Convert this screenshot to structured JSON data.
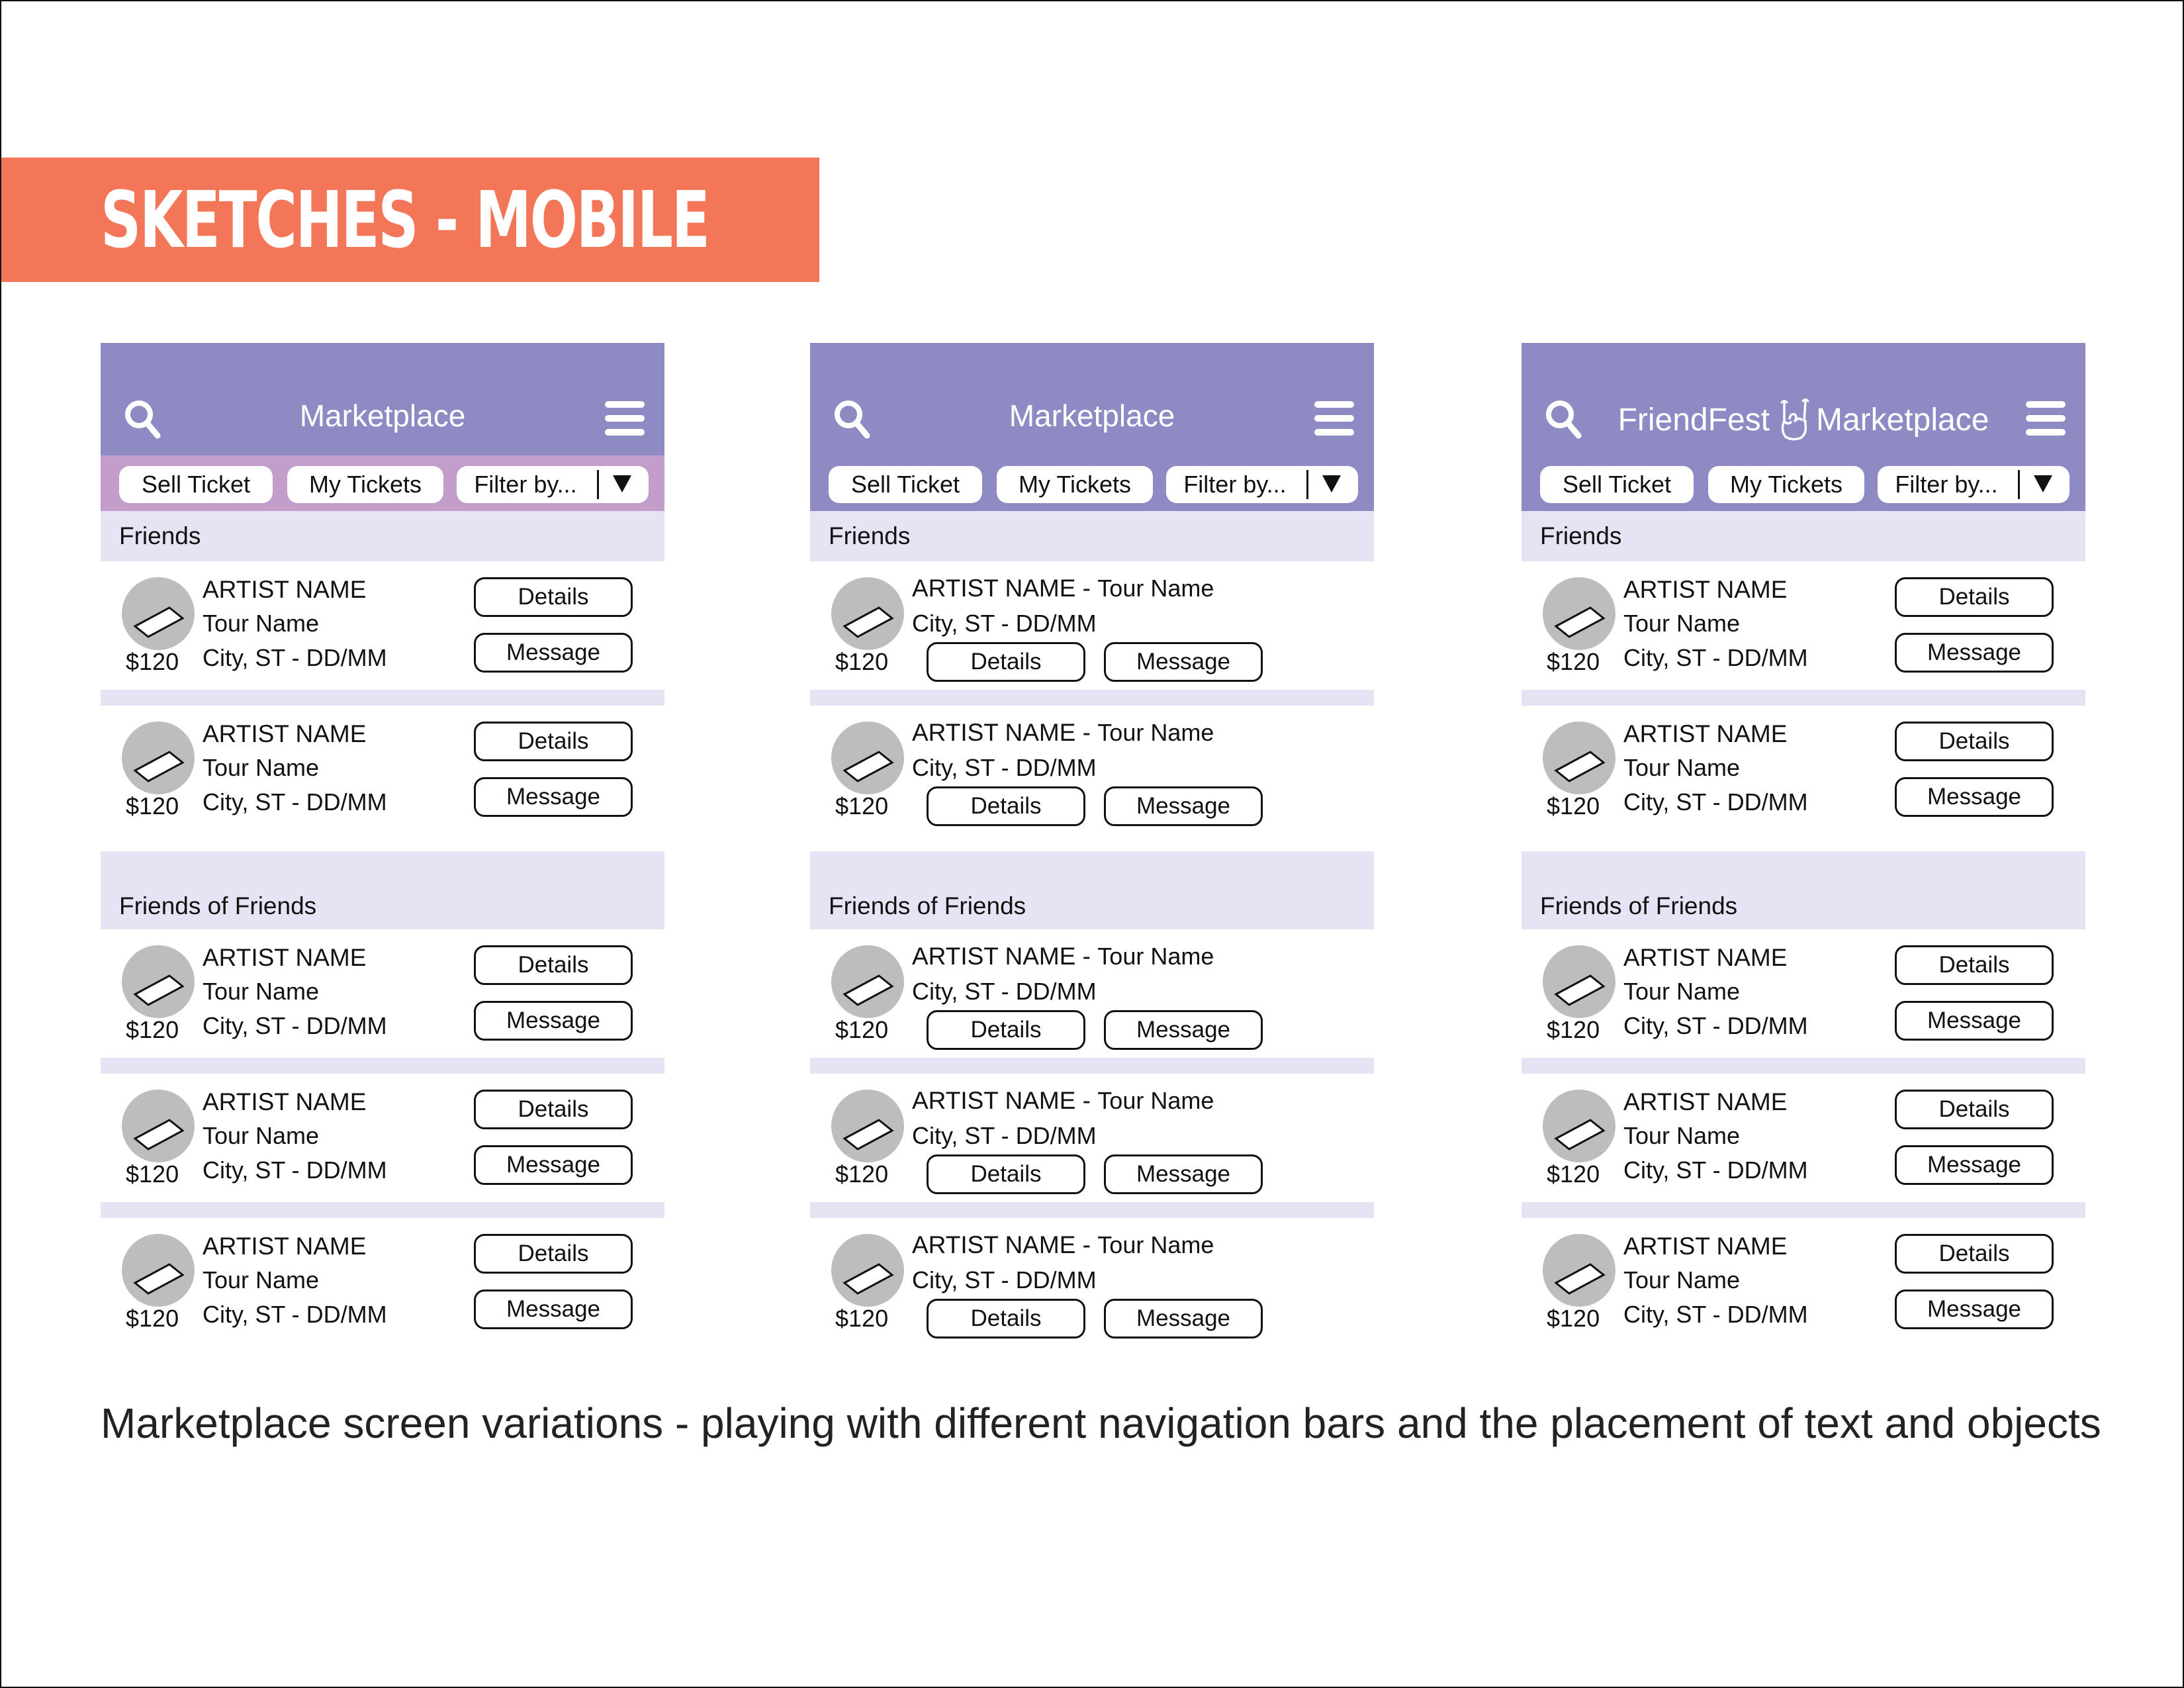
{
  "banner": {
    "title": "SKETCHES - MOBILE",
    "color": "#f47658"
  },
  "colors": {
    "header": "#8d8ac4",
    "subbar_alt": "#c39ecb",
    "section": "#e6e4f4",
    "avatar": "#bdbdbd"
  },
  "phones": [
    {
      "title": "Marketplace",
      "brand": "",
      "nav": {
        "sell": "Sell Ticket",
        "my": "My Tickets",
        "filter": "Filter by..."
      },
      "sections": {
        "friends": "Friends",
        "fof": "Friends of Friends"
      },
      "cards": [
        {
          "artist": "ARTIST NAME",
          "tour": "Tour Name",
          "city": "City, ST - DD/MM",
          "price": "$120",
          "details": "Details",
          "message": "Message"
        },
        {
          "artist": "ARTIST NAME",
          "tour": "Tour Name",
          "city": "City, ST - DD/MM",
          "price": "$120",
          "details": "Details",
          "message": "Message"
        },
        {
          "artist": "ARTIST NAME",
          "tour": "Tour Name",
          "city": "City, ST - DD/MM",
          "price": "$120",
          "details": "Details",
          "message": "Message"
        },
        {
          "artist": "ARTIST NAME",
          "tour": "Tour Name",
          "city": "City, ST - DD/MM",
          "price": "$120",
          "details": "Details",
          "message": "Message"
        },
        {
          "artist": "ARTIST NAME",
          "tour": "Tour Name",
          "city": "City, ST - DD/MM",
          "price": "$120",
          "details": "Details",
          "message": "Message"
        }
      ]
    },
    {
      "title": "Marketplace",
      "brand": "",
      "nav": {
        "sell": "Sell Ticket",
        "my": "My Tickets",
        "filter": "Filter by..."
      },
      "sections": {
        "friends": "Friends",
        "fof": "Friends of Friends"
      },
      "cards": [
        {
          "artist": "ARTIST NAME",
          "tour": "Tour Name",
          "city": "City, ST - DD/MM",
          "price": "$120",
          "details": "Details",
          "message": "Message"
        },
        {
          "artist": "ARTIST NAME",
          "tour": "Tour Name",
          "city": "City, ST - DD/MM",
          "price": "$120",
          "details": "Details",
          "message": "Message"
        },
        {
          "artist": "ARTIST NAME",
          "tour": "Tour Name",
          "city": "City, ST - DD/MM",
          "price": "$120",
          "details": "Details",
          "message": "Message"
        },
        {
          "artist": "ARTIST NAME",
          "tour": "Tour Name",
          "city": "City, ST - DD/MM",
          "price": "$120",
          "details": "Details",
          "message": "Message"
        },
        {
          "artist": "ARTIST NAME",
          "tour": "Tour Name",
          "city": "City, ST - DD/MM",
          "price": "$120",
          "details": "Details",
          "message": "Message"
        }
      ]
    },
    {
      "title": "Marketplace",
      "brand": "FriendFest",
      "nav": {
        "sell": "Sell Ticket",
        "my": "My Tickets",
        "filter": "Filter by..."
      },
      "sections": {
        "friends": "Friends",
        "fof": "Friends of Friends"
      },
      "cards": [
        {
          "artist": "ARTIST NAME",
          "tour": "Tour Name",
          "city": "City, ST - DD/MM",
          "price": "$120",
          "details": "Details",
          "message": "Message"
        },
        {
          "artist": "ARTIST NAME",
          "tour": "Tour Name",
          "city": "City, ST - DD/MM",
          "price": "$120",
          "details": "Details",
          "message": "Message"
        },
        {
          "artist": "ARTIST NAME",
          "tour": "Tour Name",
          "city": "City, ST - DD/MM",
          "price": "$120",
          "details": "Details",
          "message": "Message"
        },
        {
          "artist": "ARTIST NAME",
          "tour": "Tour Name",
          "city": "City, ST - DD/MM",
          "price": "$120",
          "details": "Details",
          "message": "Message"
        },
        {
          "artist": "ARTIST NAME",
          "tour": "Tour Name",
          "city": "City, ST - DD/MM",
          "price": "$120",
          "details": "Details",
          "message": "Message"
        }
      ]
    }
  ],
  "caption": "Marketplace screen variations - playing with different navigation bars and the placement of text and objects"
}
